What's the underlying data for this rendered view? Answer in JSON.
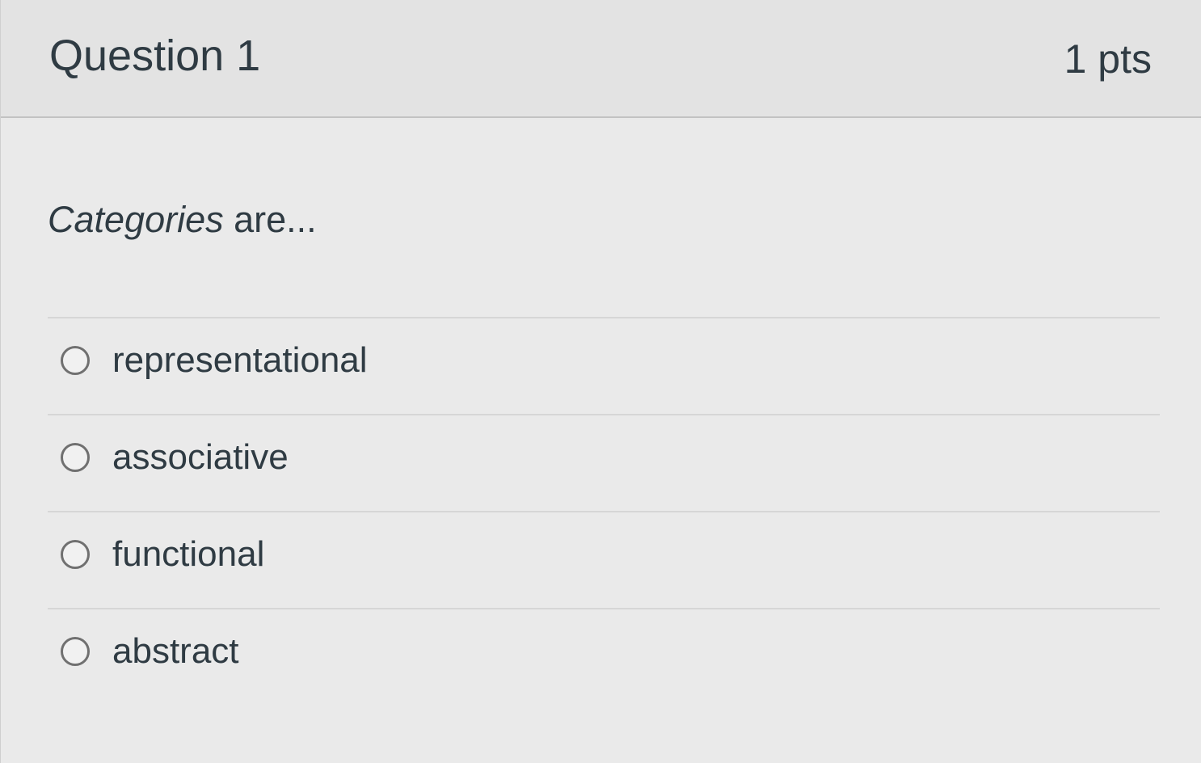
{
  "question": {
    "title": "Question 1",
    "points": "1 pts",
    "prompt_emphasis": "Categories",
    "prompt_rest": " are...",
    "answers": [
      {
        "label": "representational",
        "selected": false
      },
      {
        "label": "associative",
        "selected": false
      },
      {
        "label": "functional",
        "selected": false
      },
      {
        "label": "abstract",
        "selected": false
      }
    ]
  },
  "icons": {
    "answer_choice": "radio-button-unchecked-icon"
  }
}
